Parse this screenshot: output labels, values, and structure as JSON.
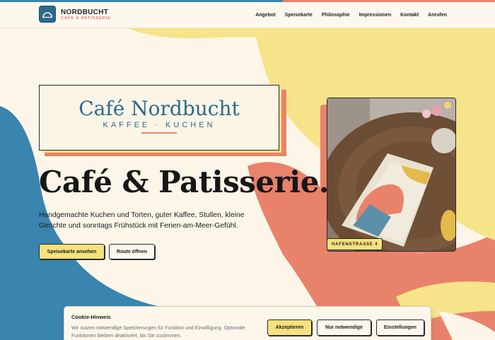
{
  "brand": {
    "name": "NORDBUCHT",
    "subtitle": "CAFÉ & PATISSERIE"
  },
  "nav": {
    "items": [
      "Angebot",
      "Speisekarte",
      "Philosophie",
      "Impressionen",
      "Kontakt",
      "Anrufen"
    ]
  },
  "hero": {
    "sign_title": "Café Nordbucht",
    "sign_subtitle": "KAFFEE · KUCHEN",
    "headline": "Café & Patisserie.",
    "intro": "Handgemachte Kuchen und Torten, guter Kaffee, Stullen, kleine Gerichte und sonntags Frühstück mit Ferien-am-Meer-Gefühl.",
    "primary_button": "Speisekarte ansehen",
    "secondary_button": "Route öffnen",
    "photo_tag": "HAFENSTRASSE 4"
  },
  "cookie": {
    "title": "Cookie-Hinweis",
    "text": "Wir nutzen notwendige Speicherungen für Funktion und Einwilligung. Optionale Funktionen bleiben deaktiviert, bis Sie zustimmen.",
    "accept": "Akzeptieren",
    "necessary": "Nur notwendige",
    "settings": "Einstellungen"
  },
  "colors": {
    "blue": "#3a84b0",
    "yellow": "#f6e17d",
    "coral": "#e9826b",
    "cream": "#fdf6e8"
  }
}
